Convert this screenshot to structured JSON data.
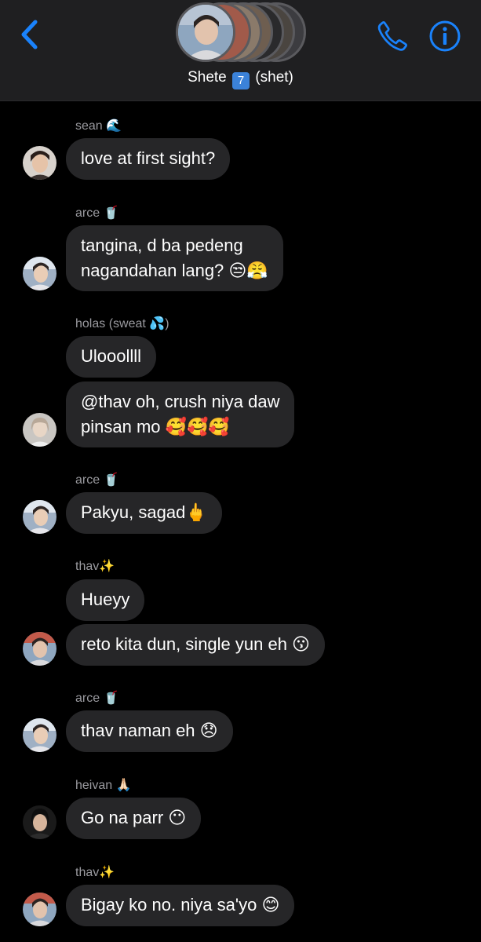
{
  "header": {
    "title_name": "Shete",
    "title_badge": "7",
    "title_suffix": "(shet)",
    "back_icon": "chevron-left-icon",
    "call_icon": "phone-icon",
    "info_icon": "info-icon",
    "accent_color": "#1a82fb"
  },
  "messages": [
    {
      "sender": "sean 🌊",
      "text": "love at first sight?",
      "avatar": "avatar-sean"
    },
    {
      "sender": "arce 🥤",
      "text_lines": [
        "tangina, d ba pedeng",
        "nagandahan lang? 😒😤"
      ],
      "avatar": "avatar-arce"
    },
    {
      "sender": "holas (sweat 💦)",
      "text": "Ulooollll"
    },
    {
      "text_lines": [
        "@thav oh, crush niya daw",
        "pinsan mo 🥰🥰🥰"
      ],
      "avatar": "avatar-holas"
    },
    {
      "sender": "arce 🥤",
      "text": "Pakyu, sagad🖕",
      "avatar": "avatar-arce"
    },
    {
      "sender": "thav✨",
      "text": "Hueyy"
    },
    {
      "text": "reto kita dun, single yun eh 😗",
      "avatar": "avatar-thav"
    },
    {
      "sender": "arce 🥤",
      "text": "thav naman eh 😞",
      "avatar": "avatar-arce"
    },
    {
      "sender": "heivan 🙏🏻",
      "text": "Go na parr 😶",
      "avatar": "avatar-heivan"
    },
    {
      "sender": "thav✨",
      "text": "Bigay ko no. niya sa'yo 😊",
      "avatar": "avatar-thav"
    }
  ]
}
